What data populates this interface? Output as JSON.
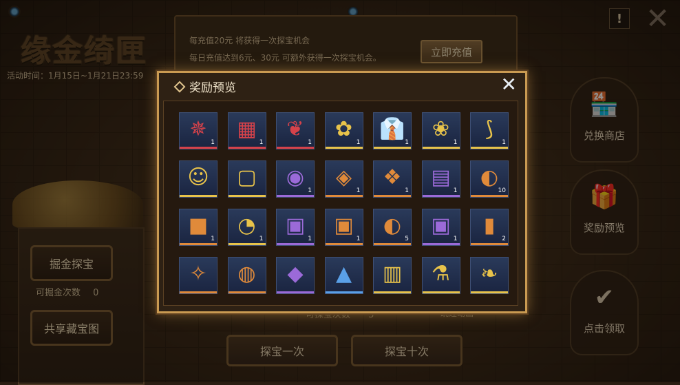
{
  "header": {
    "logo_title": "缘金绮匣",
    "event_time": "活动时间：1月15日~1月21日23:59",
    "help_label": "!",
    "close_glyph": "✕"
  },
  "info": {
    "line1": "每充值20元 将获得一次探宝机会",
    "line2": "每日充值达到6元、30元 可额外获得一次探宝机会。",
    "recharge_button": "立即充值"
  },
  "side_menu": [
    {
      "label": "兑换商店",
      "icon": "shop-icon",
      "glyph": "🏪"
    },
    {
      "label": "奖励预览",
      "icon": "gift-icon",
      "glyph": "🎁"
    },
    {
      "label": "点击领取",
      "icon": "claim-check-icon",
      "glyph": "✔"
    }
  ],
  "left": {
    "dig_button": "掘金探宝",
    "dig_count_label": "可掘金次数",
    "dig_count_value": "0",
    "share_button": "共享藏宝图"
  },
  "bottom": {
    "remaining_label": "可探宝次数",
    "remaining_value": "3",
    "skip_label": "跳过动画",
    "once_button": "探宝一次",
    "ten_button": "探宝十次"
  },
  "popup": {
    "title": "奖励预览",
    "close_glyph": "✕",
    "items": [
      {
        "name": "silver-emblem",
        "glyph": "✵",
        "rarity": "#d6424a",
        "qty": "1"
      },
      {
        "name": "blue-room-scene",
        "glyph": "▦",
        "rarity": "#d6424a",
        "qty": "1"
      },
      {
        "name": "feather-headdress",
        "glyph": "❦",
        "rarity": "#d6424a",
        "qty": "1"
      },
      {
        "name": "pink-sticker",
        "glyph": "✿",
        "rarity": "#e8c34a",
        "qty": "1"
      },
      {
        "name": "blue-outfit",
        "glyph": "👔",
        "rarity": "#e8c34a",
        "qty": "1"
      },
      {
        "name": "blonde-hair",
        "glyph": "❀",
        "rarity": "#e8c34a",
        "qty": "1"
      },
      {
        "name": "green-antenna",
        "glyph": "⟆",
        "rarity": "#e8c34a",
        "qty": "1"
      },
      {
        "name": "avatar-portrait",
        "glyph": "☺",
        "rarity": "#e8c34a",
        "qty": ""
      },
      {
        "name": "frame-border",
        "glyph": "▢",
        "rarity": "#e8c34a",
        "qty": ""
      },
      {
        "name": "purple-sack",
        "glyph": "◉",
        "rarity": "#9b6ad8",
        "qty": "1"
      },
      {
        "name": "wood-crate",
        "glyph": "◈",
        "rarity": "#e08a3a",
        "qty": "1"
      },
      {
        "name": "gold-cube",
        "glyph": "❖",
        "rarity": "#e08a3a",
        "qty": "1"
      },
      {
        "name": "purple-chest",
        "glyph": "▤",
        "rarity": "#9b6ad8",
        "qty": "1"
      },
      {
        "name": "ticket-card",
        "glyph": "◐",
        "rarity": "#e08a3a",
        "qty": "10"
      },
      {
        "name": "dark-cube",
        "glyph": "■",
        "rarity": "#e08a3a",
        "qty": "1"
      },
      {
        "name": "crystal-orb",
        "glyph": "◔",
        "rarity": "#e8c34a",
        "qty": "1"
      },
      {
        "name": "blue-box-a",
        "glyph": "▣",
        "rarity": "#9b6ad8",
        "qty": "1"
      },
      {
        "name": "blue-box-b",
        "glyph": "▣",
        "rarity": "#e08a3a",
        "qty": "1"
      },
      {
        "name": "ticket-card-2",
        "glyph": "◐",
        "rarity": "#e08a3a",
        "qty": "5"
      },
      {
        "name": "blue-box-c",
        "glyph": "▣",
        "rarity": "#9b6ad8",
        "qty": "1"
      },
      {
        "name": "spray-can",
        "glyph": "▮",
        "rarity": "#e08a3a",
        "qty": "2"
      },
      {
        "name": "gold-crystal",
        "glyph": "✧",
        "rarity": "#e08a3a",
        "qty": ""
      },
      {
        "name": "gear-orb",
        "glyph": "◍",
        "rarity": "#e08a3a",
        "qty": ""
      },
      {
        "name": "purple-shard",
        "glyph": "◆",
        "rarity": "#9b6ad8",
        "qty": ""
      },
      {
        "name": "blue-prism",
        "glyph": "▲",
        "rarity": "#5aa0e8",
        "qty": ""
      },
      {
        "name": "blue-chest",
        "glyph": "▥",
        "rarity": "#e8c34a",
        "qty": ""
      },
      {
        "name": "green-potion",
        "glyph": "⚗",
        "rarity": "#e8c34a",
        "qty": ""
      },
      {
        "name": "green-sprout-orb",
        "glyph": "❧",
        "rarity": "#e8c34a",
        "qty": ""
      }
    ]
  }
}
